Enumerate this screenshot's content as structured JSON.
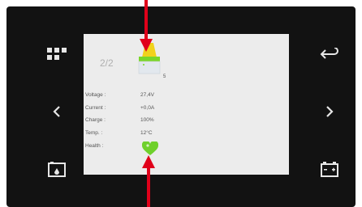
{
  "screen": {
    "page_indicator": "2/2",
    "battery_number": "5",
    "rows": [
      {
        "label": "Voltage  :",
        "value": "27,4V"
      },
      {
        "label": "Current  :",
        "value": "+0,0A"
      },
      {
        "label": "Charge   :",
        "value": "100%"
      },
      {
        "label": "Temp.    :",
        "value": "12°C"
      },
      {
        "label": "Health   :",
        "value": ""
      }
    ]
  },
  "icons": {
    "left": [
      "grid-menu-icon",
      "chevron-left-icon",
      "battery-gauge-icon"
    ],
    "right": [
      "back-arrow-icon",
      "chevron-right-icon",
      "battery-icon"
    ],
    "battery_screen_icon": "battery-full-icon",
    "health_icon": "heart-icon"
  },
  "colors": {
    "bezel": "#121212",
    "screen": "#ececec",
    "battery_green": "#7ad62a",
    "battery_yellow": "#f1d21c",
    "heart_green": "#6fd02c",
    "arrow_red": "#e0001a"
  }
}
